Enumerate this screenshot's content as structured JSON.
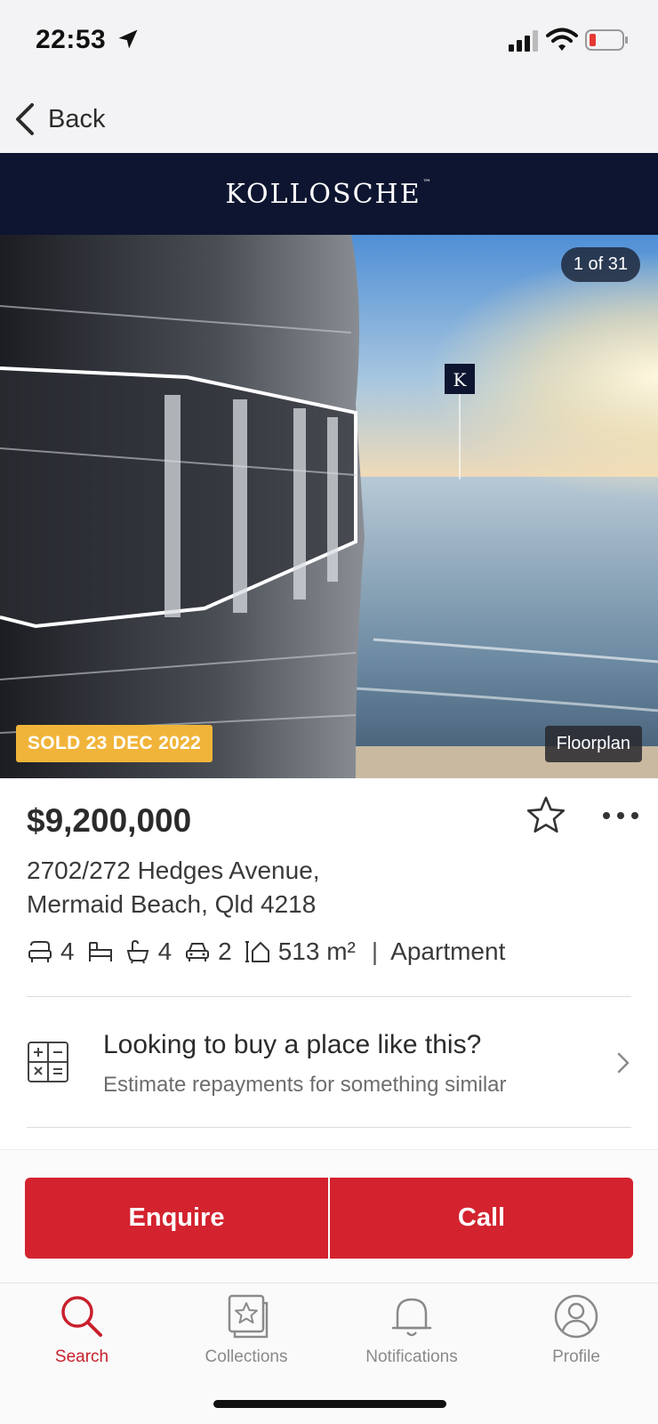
{
  "status_bar": {
    "time": "22:53",
    "icons": [
      "location-arrow-icon",
      "cellular-signal-icon",
      "wifi-icon",
      "battery-low-icon"
    ],
    "battery_color": "#e53935"
  },
  "nav": {
    "back_label": "Back"
  },
  "agency": {
    "logo_text": "KOLLOSCHE",
    "banner_color": "#0d1530"
  },
  "gallery": {
    "counter": "1 of 31",
    "status_badge": "SOLD 23 DEC 2022",
    "floorplan_label": "Floorplan"
  },
  "listing": {
    "price": "$9,200,000",
    "address_line1": "2702/272 Hedges Avenue,",
    "address_line2": "Mermaid Beach, Qld 4218",
    "features": {
      "beds": "4",
      "baths": "4",
      "cars": "2",
      "land_size": "513 m²",
      "separator": "|",
      "property_type": "Apartment"
    }
  },
  "promo": {
    "title": "Looking to buy a place like this?",
    "subtitle": "Estimate repayments for something similar"
  },
  "actions": {
    "enquire_label": "Enquire",
    "call_label": "Call",
    "accent_color": "#d3232f"
  },
  "tabs": [
    {
      "label": "Search",
      "icon": "search-icon",
      "active": true
    },
    {
      "label": "Collections",
      "icon": "collections-icon",
      "active": false
    },
    {
      "label": "Notifications",
      "icon": "bell-icon",
      "active": false
    },
    {
      "label": "Profile",
      "icon": "profile-icon",
      "active": false
    }
  ]
}
